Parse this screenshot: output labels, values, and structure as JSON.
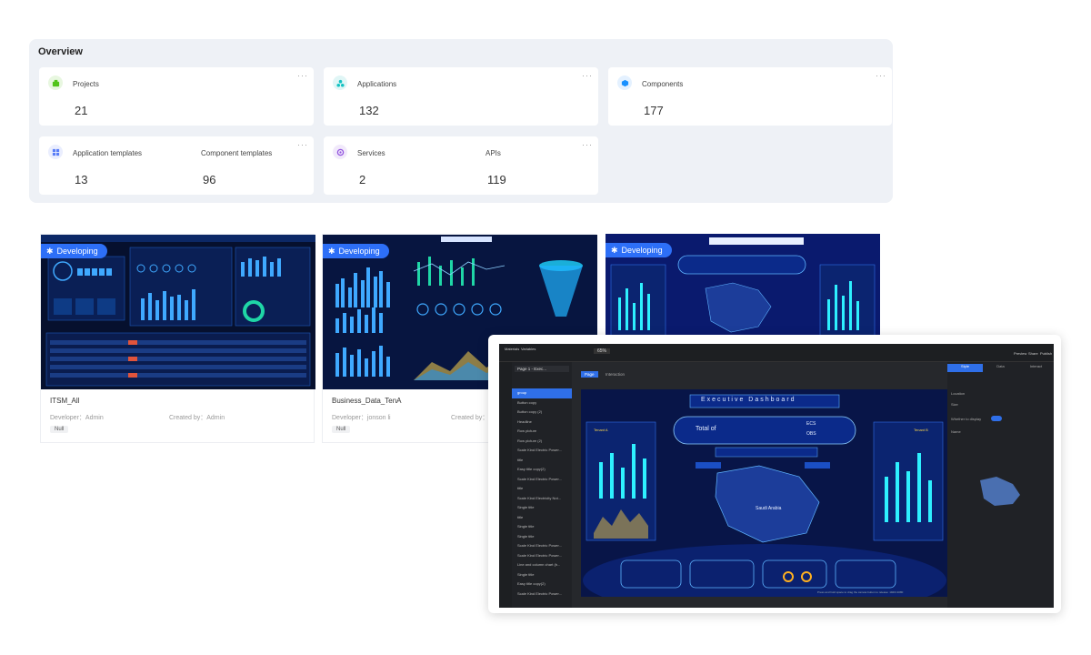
{
  "overview": {
    "title": "Overview",
    "cards": [
      {
        "label": "Projects",
        "value": "21",
        "icon": "project-icon",
        "color": "#52c41a"
      },
      {
        "label": "Applications",
        "value": "132",
        "icon": "application-icon",
        "color": "#13c2c2"
      },
      {
        "label": "Components",
        "value": "177",
        "icon": "component-icon",
        "color": "#1890ff"
      }
    ],
    "templates": {
      "icon": "template-icon",
      "color": "#597ef7",
      "app_label": "Application templates",
      "app_value": "13",
      "comp_label": "Component templates",
      "comp_value": "96"
    },
    "services": {
      "icon": "service-icon",
      "color": "#9254de",
      "services_label": "Services",
      "services_value": "2",
      "apis_label": "APIs",
      "apis_value": "119"
    },
    "more": "···"
  },
  "projects": [
    {
      "name": "ITSM_All",
      "badge": "Developing",
      "developer": "Developer：Admin",
      "created_by": "Created by：Admin",
      "tag": "Null"
    },
    {
      "name": "Business_Data_TenA",
      "badge": "Developing",
      "developer": "Developer：jonson li",
      "created_by": "Created by：J",
      "tag": "Null"
    },
    {
      "badge": "Developing"
    }
  ],
  "editor": {
    "page_select": "Page 1 - Exec...",
    "zoom": "65%",
    "tabs": [
      "Page",
      "Interaction"
    ],
    "props_tabs": [
      "Style",
      "Data",
      "Interact"
    ],
    "layers": [
      "group",
      "Button copy",
      "Button copy (2)",
      "Headline",
      "Row picture",
      "Row picture (2)",
      "Scale Kind Electric Power...",
      "title",
      "Easy title copy(2)",
      "Scale Kind Electric Power...",
      "title",
      "Scale Kind Electricity Not...",
      "Single title",
      "title",
      "Single title",
      "Single title",
      "Scale Kind Electric Power...",
      "Scale Kind Electric Power...",
      "Line and column chart (b...",
      "Single title",
      "Easy title copy(2)",
      "Scale Kind Electric Power..."
    ],
    "canvas_title": "Executive Dashboard",
    "total_label": "Total of",
    "ecs_label": "ECS",
    "obs_label": "OBS",
    "region_label": "Saudi Arabia",
    "tenant_a": "Tenant A",
    "tenant_b": "Tenant B",
    "toolbar_labels": [
      "Materials",
      "Variables",
      "Preview",
      "Share",
      "Publish"
    ],
    "props": [
      "Location",
      "Size",
      "Whether to display",
      "Name"
    ],
    "footer": "Press and hold space to drag the canvas button to release: 1920×1080"
  }
}
